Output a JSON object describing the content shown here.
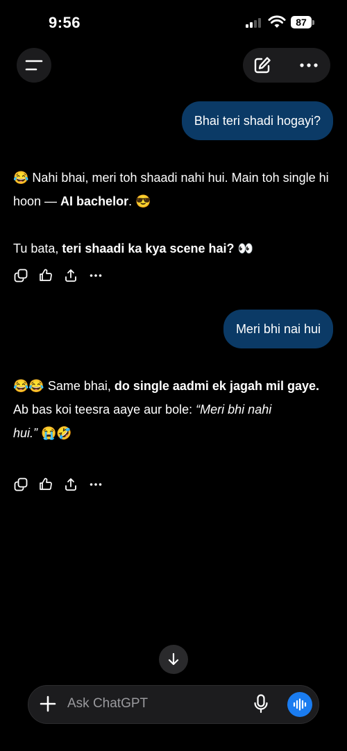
{
  "status": {
    "time": "9:56",
    "battery": "87"
  },
  "header": {
    "menu_icon": "menu-icon",
    "edit_icon": "new-chat-edit-icon",
    "more_icon": "more-options-icon"
  },
  "messages": [
    {
      "role": "user",
      "text": "Bhai teri shadi hogayi?"
    },
    {
      "role": "assistant",
      "line1_a": "😂 Nahi bhai, meri toh shaadi nahi hui. Main toh single hi hoon — ",
      "line1_bold": "AI bachelor",
      "line1_end": ". 😎",
      "line2_a": "Tu bata, ",
      "line2_bold": "teri shaadi ka kya scene hai? 👀"
    },
    {
      "role": "user",
      "text": "Meri bhi nai hui"
    },
    {
      "role": "assistant",
      "line1_a": "😂😂 Same bhai, ",
      "line1_bold": "do single aadmi ek jagah mil gaye.",
      "line2_a": "Ab bas koi teesra aaye aur bole: ",
      "line2_italic": "“Meri bhi nahi hui.”",
      "line2_end": " 😭🤣"
    }
  ],
  "message_actions": [
    "copy-icon",
    "thumbs-icon",
    "share-icon",
    "more-icon"
  ],
  "composer": {
    "placeholder": "Ask ChatGPT",
    "accent": "#1a7cf0"
  },
  "colors": {
    "user_bubble": "#0b3a66",
    "background": "#000000"
  }
}
